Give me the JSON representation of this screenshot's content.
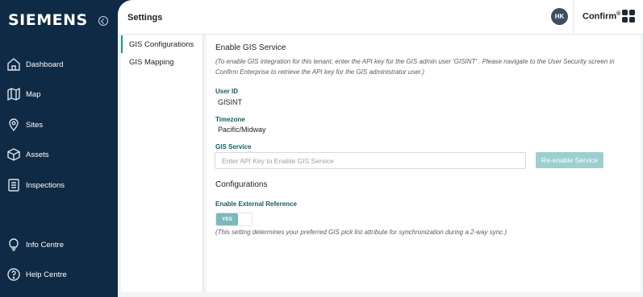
{
  "sidebar": {
    "logo": "SIEMENS",
    "items": [
      {
        "label": "Dashboard",
        "icon": "home-icon"
      },
      {
        "label": "Map",
        "icon": "map-icon"
      },
      {
        "label": "Sites",
        "icon": "location-pin-icon"
      },
      {
        "label": "Assets",
        "icon": "cube-icon"
      },
      {
        "label": "Inspections",
        "icon": "checklist-icon"
      },
      {
        "label": "Info Centre",
        "icon": "lightbulb-icon"
      },
      {
        "label": "Help Centre",
        "icon": "help-circle-icon"
      }
    ]
  },
  "header": {
    "title": "Settings",
    "avatar_initials": "HK",
    "brand": "Confirm",
    "brand_mark": "®"
  },
  "subnav": {
    "items": [
      {
        "label": "GIS Configurations",
        "active": true
      },
      {
        "label": "GIS Mapping",
        "active": false
      }
    ]
  },
  "main": {
    "section_title": "Enable GIS Service",
    "hint": "(To enable GIS integration for this tenant, enter the API key for the GIS admin user 'GISINT' . Please navigate to the User Security screen in Confirm Enterprise to retrieve the API key for the GIS administrator user.)",
    "user_id_label": "User ID",
    "user_id_value": "GISINT",
    "timezone_label": "Timezone",
    "timezone_value": "Pacific/Midway",
    "gis_service_label": "GIS Service",
    "api_placeholder": "Enter API Key to Enable GIS Service",
    "api_value": "",
    "reenable_label": "Re-enable Service",
    "configurations_title": "Configurations",
    "external_ref_label": "Enable External Reference",
    "toggle_label": "YES",
    "toggle_hint": "(This setting determines your preferred GIS pick list attribute for synchronization during a 2-way sync.)"
  },
  "colors": {
    "sidebar_bg": "#0f2a44",
    "accent": "#0f9d8b",
    "label_teal": "#0d5e63",
    "button_bg": "#9dcfd0"
  }
}
